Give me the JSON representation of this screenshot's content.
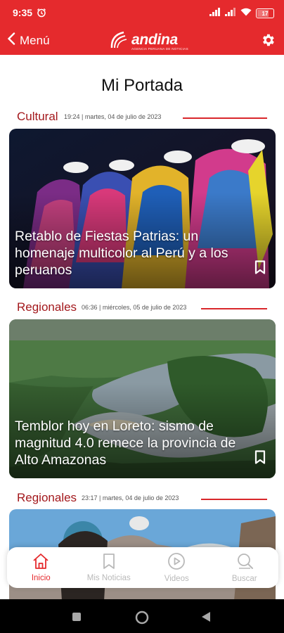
{
  "status_bar": {
    "time": "9:35",
    "battery": "17"
  },
  "header": {
    "back_label": "Menú",
    "logo_text": "andina",
    "logo_subtext": "AGENCIA PERUANA DE NOTICIAS"
  },
  "page": {
    "title": "Mi Portada"
  },
  "articles": [
    {
      "category": "Cultural",
      "meta": "19:24 | martes, 04 de julio de 2023",
      "title": "Retablo de Fiestas Patrias: un homenaje multicolor al Perú y a los peruanos"
    },
    {
      "category": "Regionales",
      "meta": "06:36 | miércoles, 05 de julio de 2023",
      "title": "Temblor hoy en Loreto: sismo de magnitud 4.0 remece la provincia de Alto Amazonas"
    },
    {
      "category": "Regionales",
      "meta": "23:17 | martes, 04 de julio de 2023",
      "title": ""
    }
  ],
  "bottom_nav": [
    {
      "label": "Inicio",
      "icon": "home-icon",
      "active": true
    },
    {
      "label": "Mis Noticias",
      "icon": "bookmark-icon",
      "active": false
    },
    {
      "label": "Videos",
      "icon": "play-icon",
      "active": false
    },
    {
      "label": "Buscar",
      "icon": "search-icon",
      "active": false
    }
  ],
  "colors": {
    "brand": "#e52a2d",
    "category": "#a3181c",
    "inactive": "#b9b9b9"
  }
}
